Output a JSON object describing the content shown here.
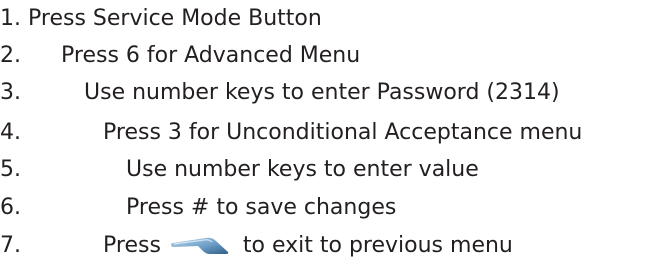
{
  "steps": [
    {
      "number": "1.",
      "text": "Press Service Mode Button"
    },
    {
      "number": "2.",
      "text": "Press 6 for Advanced Menu"
    },
    {
      "number": "3.",
      "text": "Use number keys to enter Password (2314)"
    },
    {
      "number": "4.",
      "text": "Press 3 for Unconditional Acceptance menu"
    },
    {
      "number": "5.",
      "text": "Use number keys to enter value"
    },
    {
      "number": "6.",
      "text": "Press # to save changes"
    },
    {
      "number": "7.",
      "text_before": "Press",
      "text_after": "to exit to previous menu",
      "icon": "escape-key-icon"
    }
  ],
  "colors": {
    "text": "#231f20",
    "icon_dark": "#3a6f9a",
    "icon_light": "#9cc3e0"
  }
}
